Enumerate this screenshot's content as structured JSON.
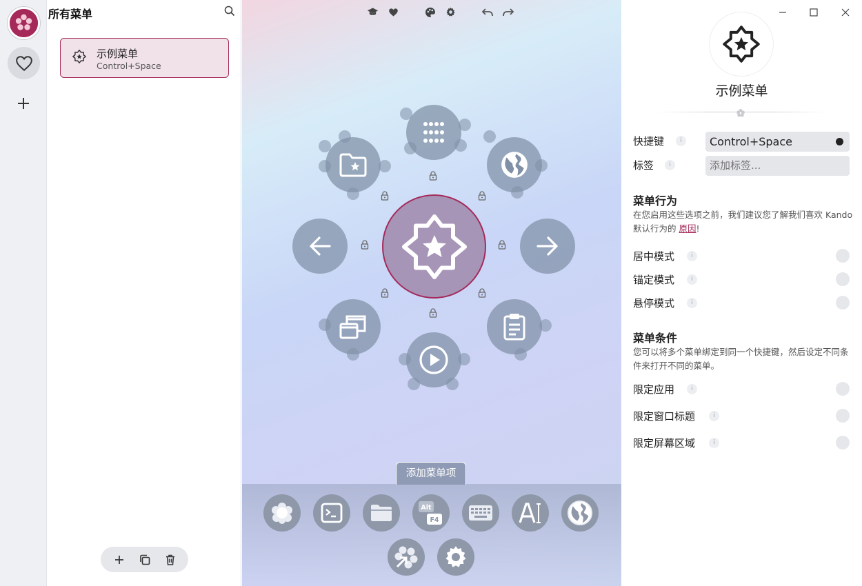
{
  "sidebar": {
    "title": "所有菜单",
    "menus": [
      {
        "name": "示例菜单",
        "shortcut": "Control+Space"
      }
    ]
  },
  "toolbar": {
    "icons": [
      "learn-icon",
      "heart-icon",
      "palette-icon",
      "gear-icon",
      "undo-icon",
      "redo-icon"
    ]
  },
  "preview": {
    "center_icon": "star-badge-icon",
    "children": [
      {
        "icon": "apps-grid-icon",
        "direction": "up"
      },
      {
        "icon": "globe-icon",
        "direction": "up-right"
      },
      {
        "icon": "arrow-right-icon",
        "direction": "right"
      },
      {
        "icon": "clipboard-icon",
        "direction": "down-right"
      },
      {
        "icon": "play-icon",
        "direction": "down"
      },
      {
        "icon": "windows-icon",
        "direction": "down-left"
      },
      {
        "icon": "arrow-left-icon",
        "direction": "left"
      },
      {
        "icon": "folder-star-icon",
        "direction": "up-left"
      }
    ],
    "add_label": "添加菜单项",
    "add_items": [
      "submenu-icon",
      "terminal-icon",
      "folder-icon",
      "hotkey-alt-f4-icon",
      "keyboard-macro-icon",
      "text-icon",
      "uri-icon",
      "redirect-icon",
      "settings-icon"
    ],
    "hotkey_badge": [
      "Alt",
      "F4"
    ]
  },
  "properties": {
    "menu_name": "示例菜单",
    "shortcut_label": "快捷键",
    "shortcut_value": "Control+Space",
    "tags_label": "标签",
    "tags_placeholder": "添加标签...",
    "behavior_title": "菜单行为",
    "behavior_desc_pre": "在您启用这些选项之前，我们建议您了解我们喜欢 Kando 默认行为的 ",
    "behavior_desc_link": "原因",
    "behavior_desc_post": "!",
    "behavior_toggles": [
      "居中模式",
      "锚定模式",
      "悬停模式"
    ],
    "conditions_title": "菜单条件",
    "conditions_desc": "您可以将多个菜单绑定到同一个快捷键，然后设定不同条件来打开不同的菜单。",
    "condition_toggles": [
      "限定应用",
      "限定窗口标题",
      "限定屏幕区域"
    ],
    "info_glyph": "i"
  },
  "colors": {
    "accent": "#a52a5a",
    "node": "#8090a6",
    "center": "#a795b8"
  }
}
